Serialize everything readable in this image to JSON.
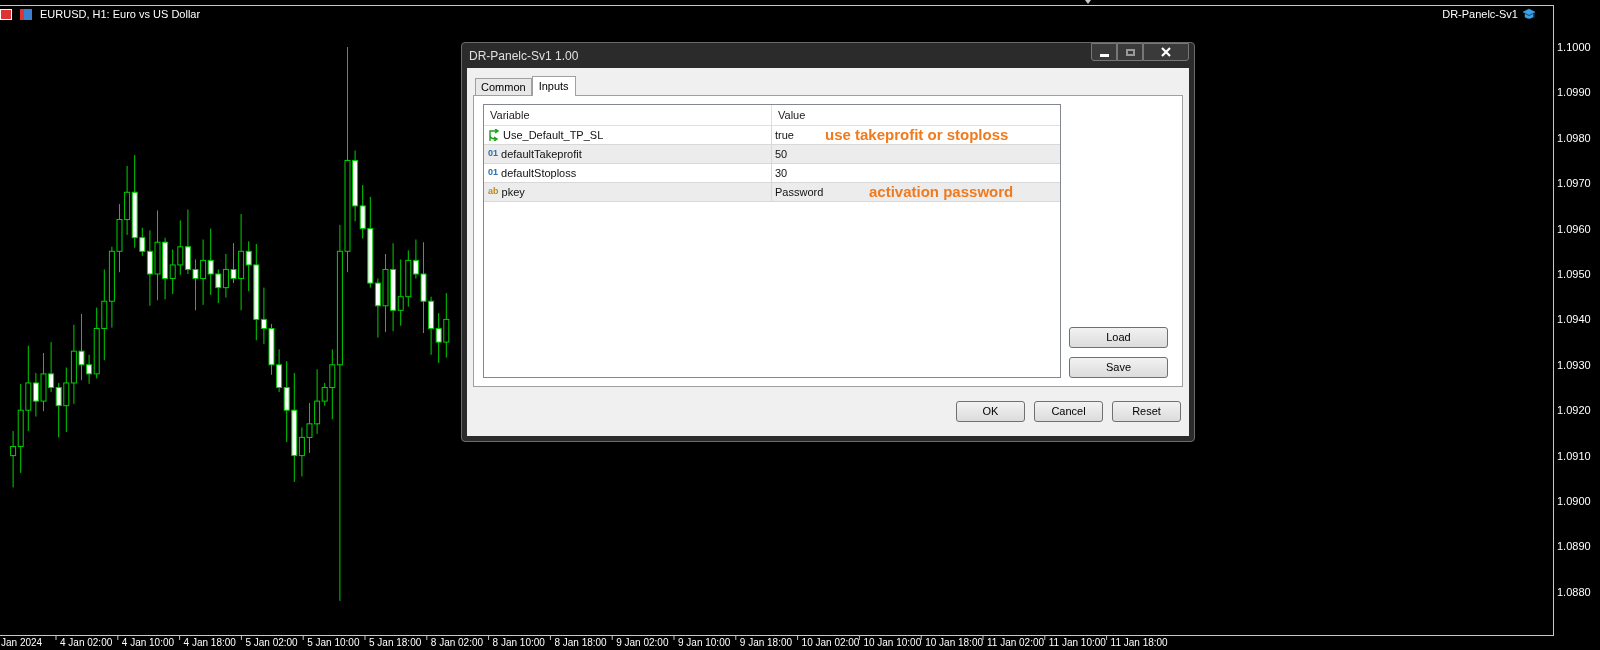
{
  "chart_window": {
    "title": "EURUSD, H1:  Euro vs US Dollar",
    "expert_label": "DR-Panelc-Sv1",
    "price_axis": [
      "1.1000",
      "1.0990",
      "1.0980",
      "1.0970",
      "1.0960",
      "1.0950",
      "1.0940",
      "1.0930",
      "1.0920",
      "1.0910",
      "1.0900",
      "1.0890",
      "1.0880"
    ],
    "time_axis": [
      "Jan 2024",
      "4 Jan 02:00",
      "4 Jan 10:00",
      "4 Jan 18:00",
      "5 Jan 02:00",
      "5 Jan 10:00",
      "5 Jan 18:00",
      "8 Jan 02:00",
      "8 Jan 10:00",
      "8 Jan 18:00",
      "9 Jan 02:00",
      "9 Jan 10:00",
      "9 Jan 18:00",
      "10 Jan 02:00",
      "10 Jan 10:00",
      "10 Jan 18:00",
      "11 Jan 02:00",
      "11 Jan 10:00",
      "11 Jan 18:00"
    ]
  },
  "dialog": {
    "title": "DR-Panelc-Sv1 1.00",
    "tabs": [
      {
        "label": "Common",
        "selected": false
      },
      {
        "label": "Inputs",
        "selected": true
      }
    ],
    "table": {
      "columns": [
        "Variable",
        "Value"
      ],
      "rows": [
        {
          "kind": "bool",
          "variable": "Use_Default_TP_SL",
          "value": "true",
          "note": "use takeprofit or stoploss"
        },
        {
          "kind": "int",
          "icon": "01",
          "variable": "defaultTakeprofit",
          "value": "50"
        },
        {
          "kind": "int",
          "icon": "01",
          "variable": "defaultStoploss",
          "value": "30"
        },
        {
          "kind": "string",
          "icon": "ab",
          "variable": "pkey",
          "value": "Password",
          "note": "activation password"
        }
      ]
    },
    "side_buttons": [
      "Load",
      "Save"
    ],
    "footer_buttons": [
      "OK",
      "Cancel",
      "Reset"
    ]
  }
}
